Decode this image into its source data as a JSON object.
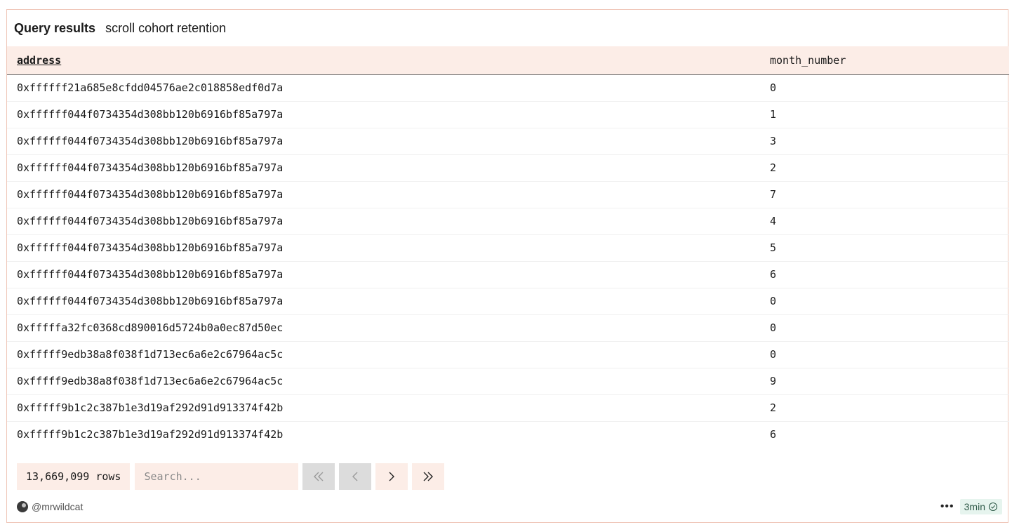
{
  "header": {
    "title": "Query results",
    "subtitle": "scroll cohort retention"
  },
  "table": {
    "columns": [
      "address",
      "month_number"
    ],
    "rows": [
      [
        "0xffffff21a685e8cfdd04576ae2c018858edf0d7a",
        "0"
      ],
      [
        "0xffffff044f0734354d308bb120b6916bf85a797a",
        "1"
      ],
      [
        "0xffffff044f0734354d308bb120b6916bf85a797a",
        "3"
      ],
      [
        "0xffffff044f0734354d308bb120b6916bf85a797a",
        "2"
      ],
      [
        "0xffffff044f0734354d308bb120b6916bf85a797a",
        "7"
      ],
      [
        "0xffffff044f0734354d308bb120b6916bf85a797a",
        "4"
      ],
      [
        "0xffffff044f0734354d308bb120b6916bf85a797a",
        "5"
      ],
      [
        "0xffffff044f0734354d308bb120b6916bf85a797a",
        "6"
      ],
      [
        "0xffffff044f0734354d308bb120b6916bf85a797a",
        "0"
      ],
      [
        "0xfffffa32fc0368cd890016d5724b0a0ec87d50ec",
        "0"
      ],
      [
        "0xfffff9edb38a8f038f1d713ec6a6e2c67964ac5c",
        "0"
      ],
      [
        "0xfffff9edb38a8f038f1d713ec6a6e2c67964ac5c",
        "9"
      ],
      [
        "0xfffff9b1c2c387b1e3d19af292d91d913374f42b",
        "2"
      ],
      [
        "0xfffff9b1c2c387b1e3d19af292d91d913374f42b",
        "6"
      ]
    ]
  },
  "pager": {
    "row_count": "13,669,099 rows",
    "search_placeholder": "Search...",
    "buttons": [
      {
        "icon": "double-chevron-left-icon",
        "enabled": false
      },
      {
        "icon": "chevron-left-icon",
        "enabled": false
      },
      {
        "icon": "chevron-right-icon",
        "enabled": true
      },
      {
        "icon": "double-chevron-right-icon",
        "enabled": true
      }
    ]
  },
  "footer": {
    "author": "@mrwildcat",
    "more_icon": "more-icon",
    "freshness": "3min",
    "freshness_icon": "check-circle-icon"
  },
  "colors": {
    "accent_bg": "#fcede7",
    "border": "#efc6b8",
    "badge_bg": "#e6f4ee",
    "badge_text": "#2e5a48"
  }
}
